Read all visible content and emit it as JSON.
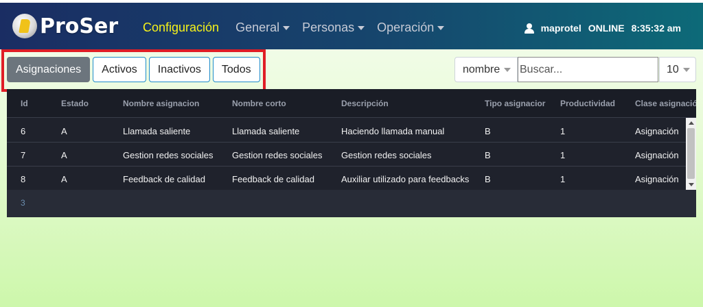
{
  "app": {
    "logo_text": "ProSer"
  },
  "nav": {
    "active": "Configuración",
    "items": [
      "General",
      "Personas",
      "Operación"
    ]
  },
  "user": {
    "name": "maprotel",
    "status": "ONLINE",
    "time": "8:35:32 am"
  },
  "tabs": [
    {
      "label": "Asignaciones",
      "active": true
    },
    {
      "label": "Activos",
      "active": false
    },
    {
      "label": "Inactivos",
      "active": false
    },
    {
      "label": "Todos",
      "active": false
    }
  ],
  "toolbar": {
    "sort_field": "nombre",
    "search_placeholder": "Buscar...",
    "page_size": "10"
  },
  "table": {
    "columns": [
      "Id",
      "Estado",
      "Nombre asignacion",
      "Nombre corto",
      "Descripción",
      "Tipo asignacior",
      "Productividad",
      "Clase asignació"
    ],
    "rows": [
      [
        "6",
        "A",
        "Llamada saliente",
        "Llamada saliente",
        "Haciendo llamada manual",
        "B",
        "1",
        "Asignación"
      ],
      [
        "7",
        "A",
        "Gestion redes sociales",
        "Gestion redes sociales",
        "Gestion redes sociales",
        "B",
        "1",
        "Asignación"
      ],
      [
        "8",
        "A",
        "Feedback de calidad",
        "Feedback de calidad",
        "Auxiliar utilizado para feedbacks",
        "B",
        "1",
        "Asignación"
      ]
    ],
    "footer_count": "3"
  },
  "colors": {
    "header_start": "#1a2d63",
    "header_end": "#0d6a78",
    "active_nav": "#f6f21a",
    "highlight": "#e01e26",
    "table_bg": "#1f222c"
  }
}
